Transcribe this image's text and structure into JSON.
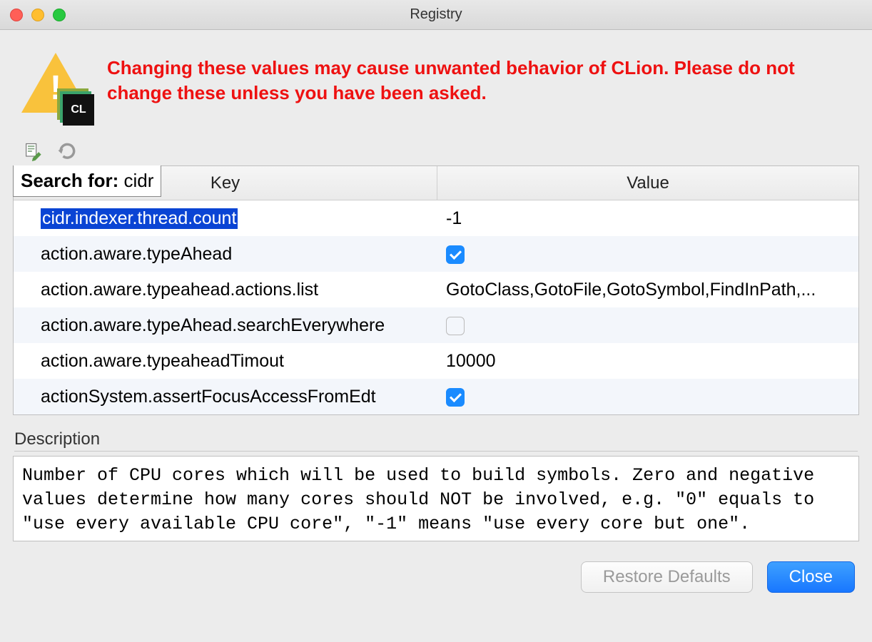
{
  "window": {
    "title": "Registry"
  },
  "warning": {
    "text": "Changing these values may cause unwanted behavior of CLion. Please do not change these unless you have been asked.",
    "badge": "CL"
  },
  "search": {
    "label": "Search for:",
    "value": "cidr"
  },
  "columns": {
    "key": "Key",
    "value": "Value"
  },
  "rows": [
    {
      "key": "cidr.indexer.thread.count",
      "value": "-1",
      "type": "text",
      "selected": true
    },
    {
      "key": "action.aware.typeAhead",
      "value": true,
      "type": "bool"
    },
    {
      "key": "action.aware.typeahead.actions.list",
      "value": "GotoClass,GotoFile,GotoSymbol,FindInPath,...",
      "type": "text"
    },
    {
      "key": "action.aware.typeAhead.searchEverywhere",
      "value": false,
      "type": "bool"
    },
    {
      "key": "action.aware.typeaheadTimout",
      "value": "10000",
      "type": "text"
    },
    {
      "key": "actionSystem.assertFocusAccessFromEdt",
      "value": true,
      "type": "bool"
    }
  ],
  "description": {
    "label": "Description",
    "text": "Number of CPU cores which will be used to build symbols. Zero and negative values determine how many cores should NOT be involved, e.g. \"0\" equals to \"use every available CPU core\", \"-1\" means \"use every core but one\"."
  },
  "buttons": {
    "restore": "Restore Defaults",
    "close": "Close"
  }
}
